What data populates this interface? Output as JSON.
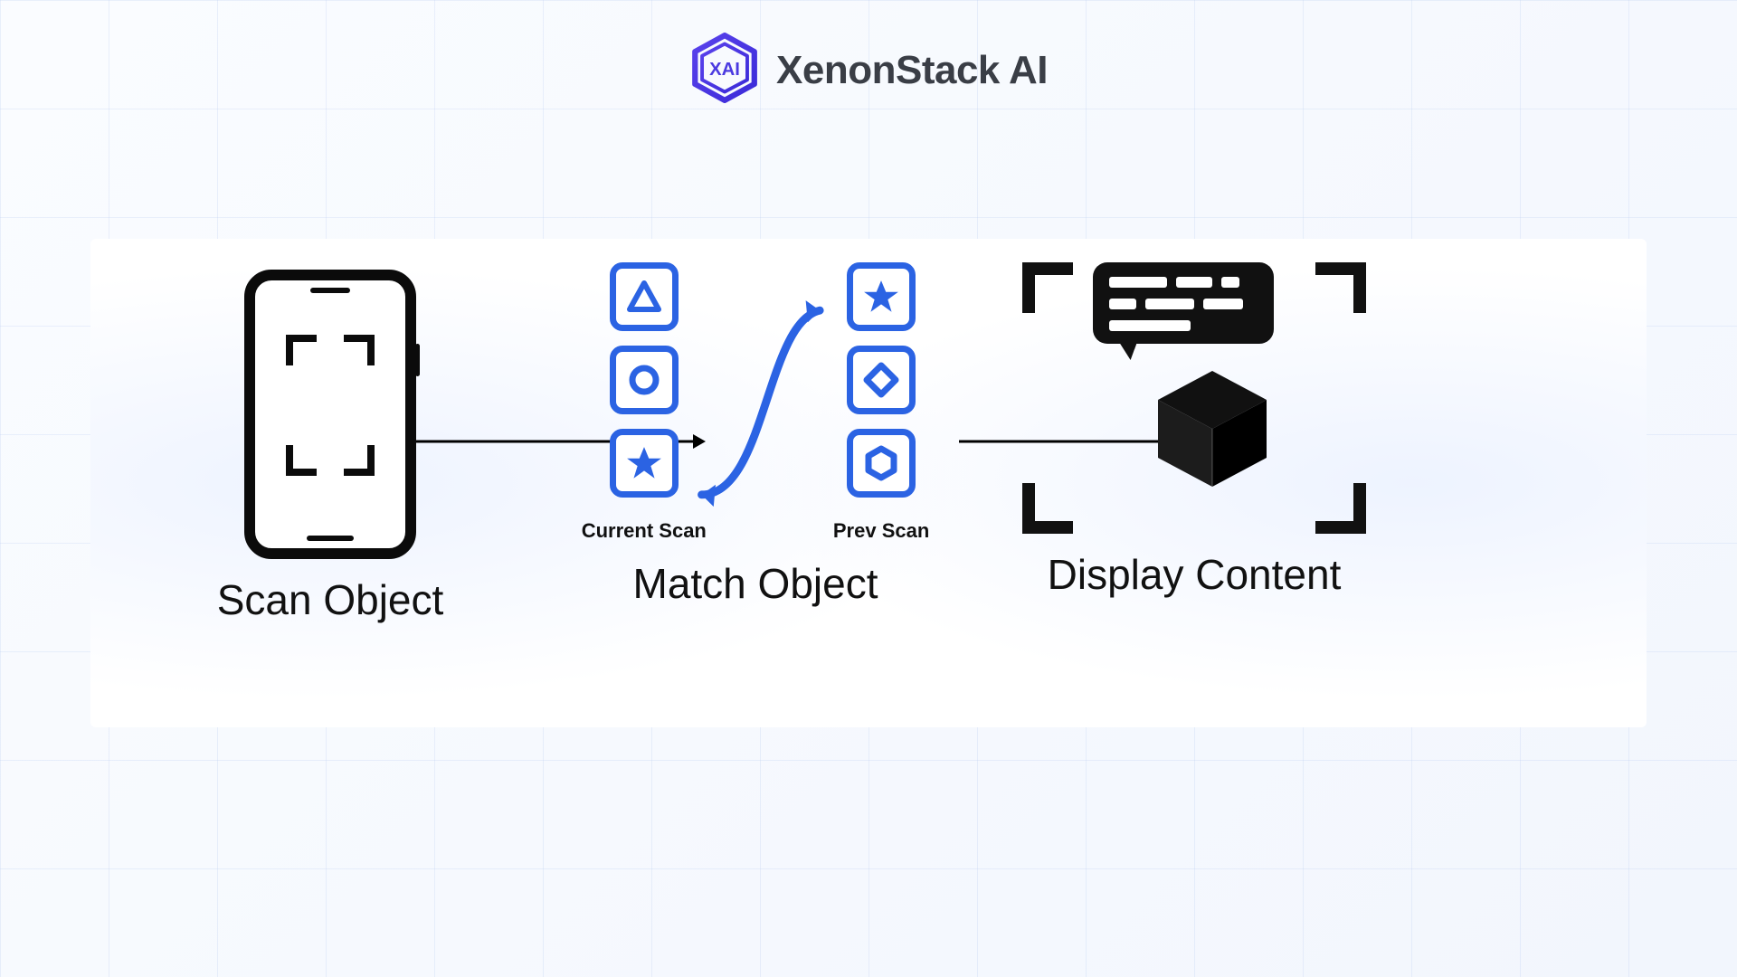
{
  "brand": {
    "name": "XenonStack AI",
    "logo_text": "XAI"
  },
  "colors": {
    "accent": "#4b3ae0",
    "tile_border": "#2b63e3",
    "ink": "#111111"
  },
  "stages": {
    "scan": {
      "title": "Scan Object"
    },
    "match": {
      "title": "Match Object",
      "current_label": "Current Scan",
      "prev_label": "Prev Scan"
    },
    "display": {
      "title": "Display Content"
    }
  },
  "match_columns": {
    "current": [
      "triangle",
      "circle",
      "star"
    ],
    "prev": [
      "star",
      "diamond",
      "hexagon"
    ]
  }
}
